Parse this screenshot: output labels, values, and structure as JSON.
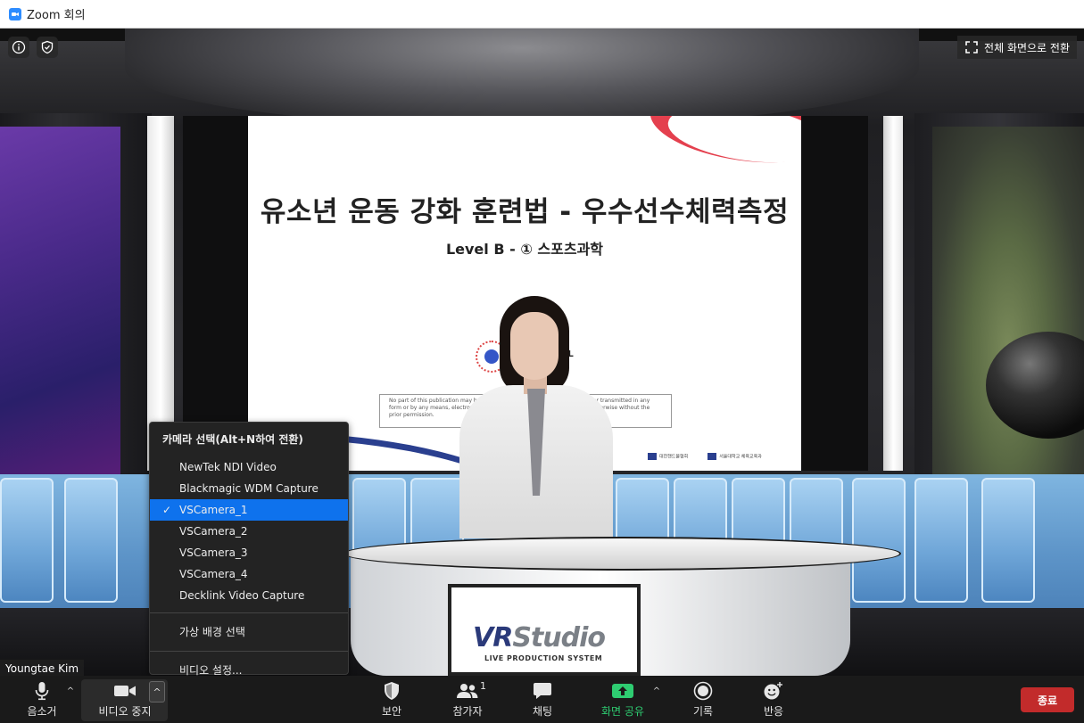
{
  "window": {
    "title": "Zoom 회의"
  },
  "stage": {
    "fullscreen_label": "전체 화면으로 전환",
    "participant_name": "Youngtae Kim"
  },
  "slide": {
    "title": "유소년 운동 강화 훈련법 - 우수선수체력측정",
    "subtitle": "Level B - ① 스포츠과학",
    "logo_text": "LL\nY",
    "disclaimer": "No part of this publication may be reproduced, stored in a retrieval system, or transmitted in any form or by any means, electronic, mechanical, photocopying, recording, or otherwise without the prior permission.",
    "footer_left": "대한핸드볼협회",
    "footer_right": "서울대학교 체육교육과"
  },
  "studio": {
    "logo_vr": "VR",
    "logo_studio": "Studio",
    "logo_tagline": "LIVE PRODUCTION SYSTEM"
  },
  "camera_menu": {
    "header": "카메라 선택(Alt+N하여 전환)",
    "cameras": [
      {
        "label": "NewTek NDI Video",
        "selected": false
      },
      {
        "label": "Blackmagic WDM Capture",
        "selected": false
      },
      {
        "label": "VSCamera_1",
        "selected": true
      },
      {
        "label": "VSCamera_2",
        "selected": false
      },
      {
        "label": "VSCamera_3",
        "selected": false
      },
      {
        "label": "VSCamera_4",
        "selected": false
      },
      {
        "label": "Decklink Video Capture",
        "selected": false
      }
    ],
    "virtual_bg": "가상 배경 선택",
    "video_settings": "비디오 설정..."
  },
  "toolbar": {
    "mute": "음소거",
    "stop_video": "비디오 중지",
    "security": "보안",
    "participants": "참가자",
    "participants_count": "1",
    "chat": "채팅",
    "share_screen": "화면 공유",
    "record": "기록",
    "reactions": "반응",
    "end": "종료"
  },
  "colors": {
    "accent": "#0e72ed",
    "share_green": "#2ecc71",
    "end_red": "#c22b2b"
  },
  "icons": [
    "zoom-icon",
    "info-icon",
    "shield-icon",
    "fullscreen-icon",
    "microphone-icon",
    "video-camera-icon",
    "shield-security-icon",
    "participants-icon",
    "chat-icon",
    "share-screen-icon",
    "record-icon",
    "reaction-icon",
    "check-icon",
    "caret-up-icon"
  ]
}
